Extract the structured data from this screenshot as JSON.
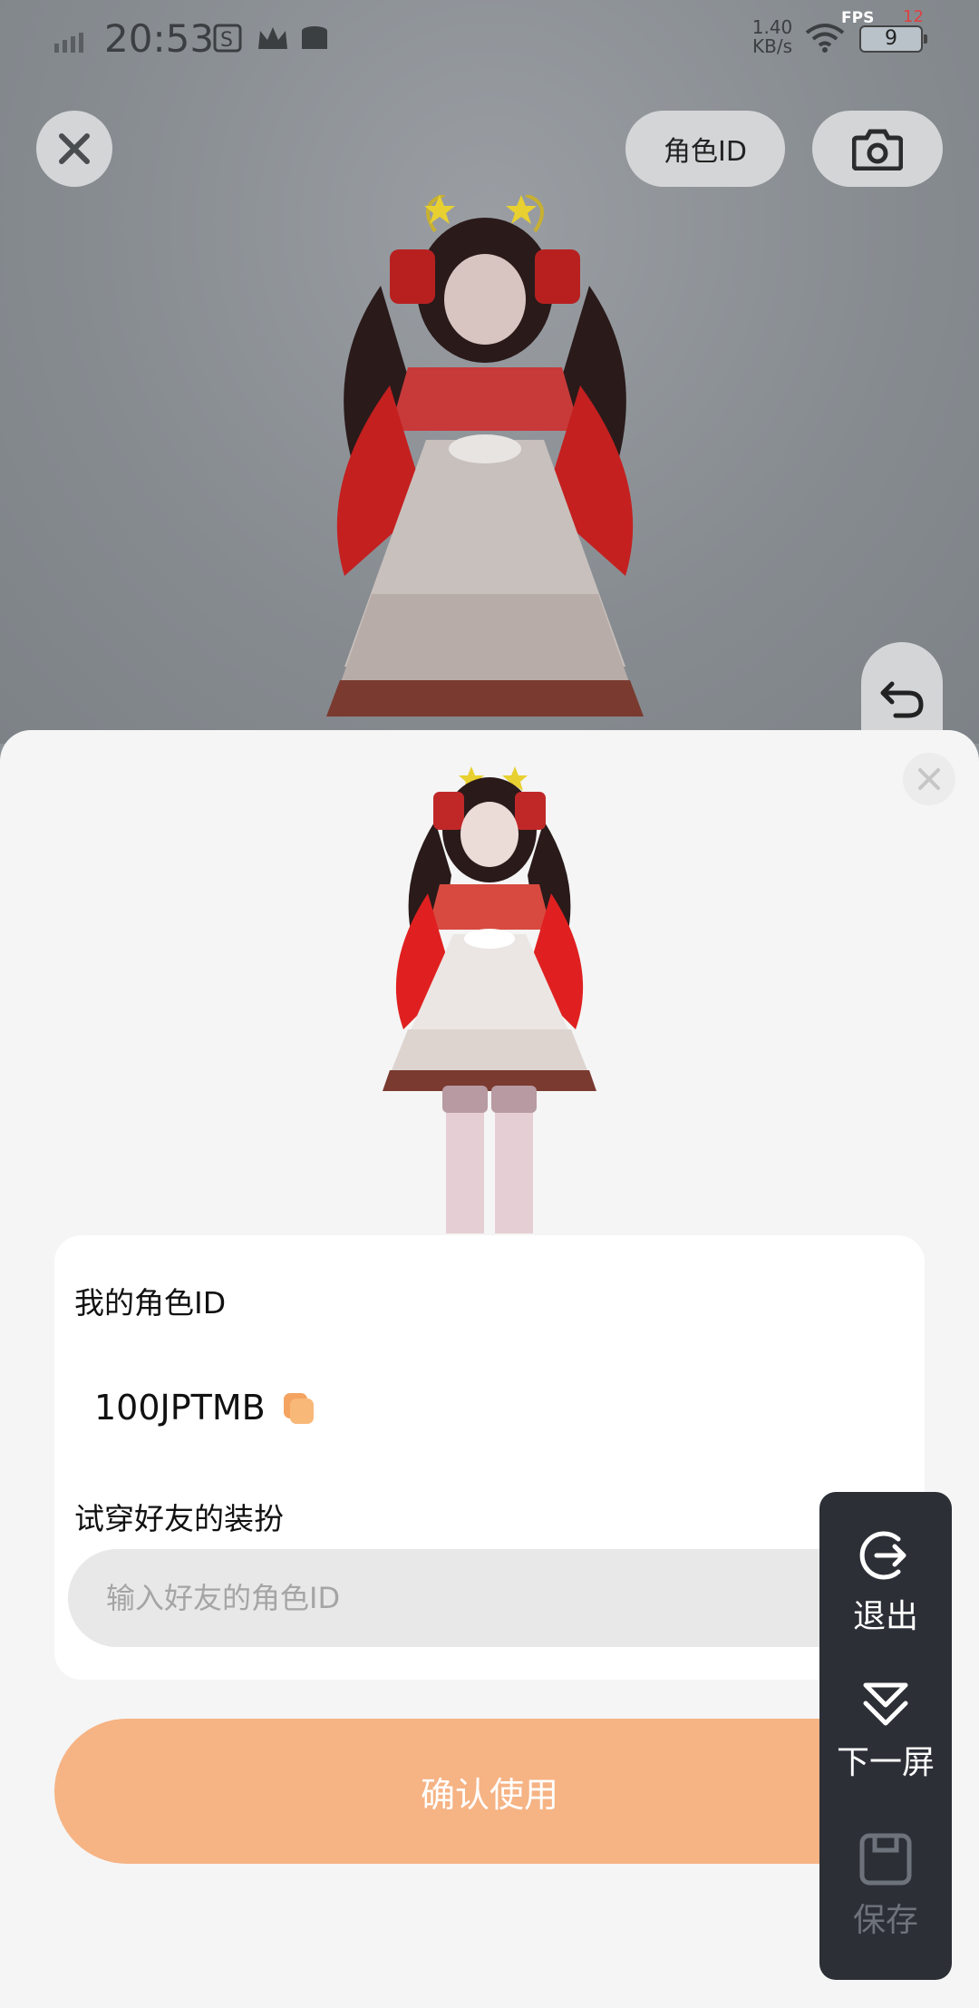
{
  "status_bar": {
    "time": "20:53",
    "net_speed_value": "1.40",
    "net_speed_unit": "KB/s",
    "fps_label": "FPS",
    "fps_value": "12",
    "battery_level": "9"
  },
  "top_bar": {
    "role_id_button": "角色ID"
  },
  "sheet": {
    "my_id_label": "我的角色ID",
    "my_id_value": "100JPTMB",
    "try_on_label": "试穿好友的装扮",
    "friend_id_placeholder": "输入好友的角色ID",
    "friend_id_value": "",
    "confirm_button": "确认使用"
  },
  "side_panel": {
    "exit_label": "退出",
    "next_screen_label": "下一屏",
    "save_label": "保存"
  },
  "colors": {
    "accent_orange": "#f6b384",
    "panel_dark": "#2c2f36",
    "disabled_gray": "#6e737b"
  }
}
